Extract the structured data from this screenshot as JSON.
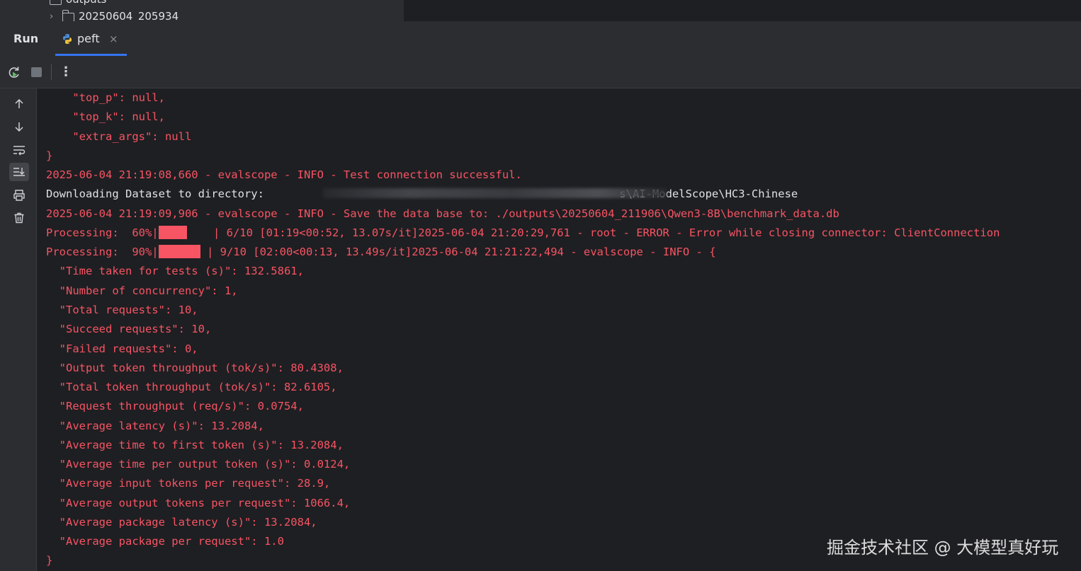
{
  "tree": {
    "row1": "outputs",
    "row2": "20250604_205934"
  },
  "panel": {
    "title": "Run",
    "tab_label": "peft",
    "tab_close": "×"
  },
  "toolbar": {
    "rerun_icon": "rerun-icon",
    "stop_icon": "stop-icon",
    "more": "⋮"
  },
  "gutter": [
    "up-arrow-icon",
    "down-arrow-icon",
    "soft-wrap-icon",
    "scroll-to-end-icon",
    "print-icon",
    "trash-icon"
  ],
  "console": {
    "l1": "    \"top_p\": null,",
    "l2": "    \"top_k\": null,",
    "l3": "    \"extra_args\": null",
    "l4": "}",
    "l5": "2025-06-04 21:19:08,660 - evalscope - INFO - Test connection successful.",
    "l6_start": "Downloading Dataset to directory: ",
    "l6_end": "s\\AI-ModelScope\\HC3-Chinese",
    "l7": "2025-06-04 21:19:09,906 - evalscope - INFO - Save the data base to: ./outputs\\20250604_211906\\Qwen3-8B\\benchmark_data.db",
    "l8_prefix": "Processing:  60%|",
    "l8_progress": 0.6,
    "l8_rest": "    | 6/10 [01:19<00:52, 13.07s/it]2025-06-04 21:20:29,761 - root - ERROR - Error while closing connector: ClientConnection",
    "l9_prefix": "Processing:  90%|",
    "l9_progress": 0.9,
    "l9_rest": " | 9/10 [02:00<00:13, 13.49s/it]2025-06-04 21:21:22,494 - evalscope - INFO - {",
    "l10": "  \"Time taken for tests (s)\": 132.5861,",
    "l11": "  \"Number of concurrency\": 1,",
    "l12": "  \"Total requests\": 10,",
    "l13": "  \"Succeed requests\": 10,",
    "l14": "  \"Failed requests\": 0,",
    "l15": "  \"Output token throughput (tok/s)\": 80.4308,",
    "l16": "  \"Total token throughput (tok/s)\": 82.6105,",
    "l17": "  \"Request throughput (req/s)\": 0.0754,",
    "l18": "  \"Average latency (s)\": 13.2084,",
    "l19": "  \"Average time to first token (s)\": 13.2084,",
    "l20": "  \"Average time per output token (s)\": 0.0124,",
    "l21": "  \"Average input tokens per request\": 28.9,",
    "l22": "  \"Average output tokens per request\": 1066.4,",
    "l23": "  \"Average package latency (s)\": 13.2084,",
    "l24": "  \"Average package per request\": 1.0",
    "l25": "}"
  },
  "watermark": "掘金技术社区 @ 大模型真好玩",
  "colors": {
    "error_red": "#f75464",
    "stdout": "#dfe1e5",
    "accent": "#3574f0",
    "panel_bg": "#2b2d30",
    "console_bg": "#1e1f22"
  }
}
